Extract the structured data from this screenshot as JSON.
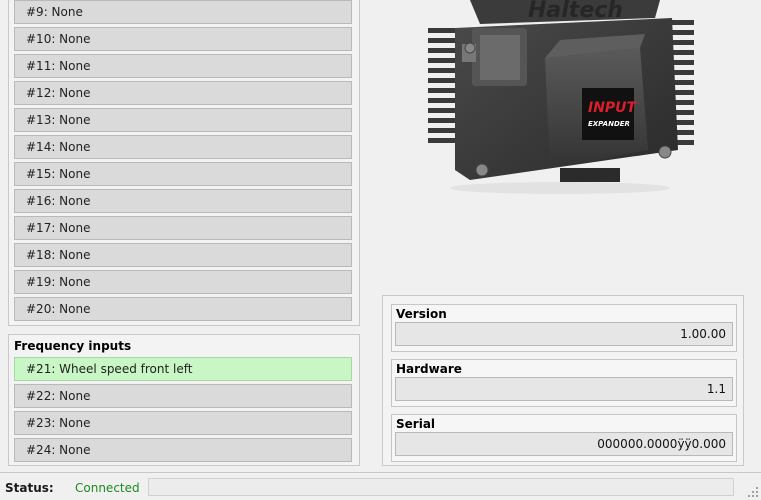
{
  "analog_inputs": [
    "#9: None",
    "#10: None",
    "#11: None",
    "#12: None",
    "#13: None",
    "#14: None",
    "#15: None",
    "#16: None",
    "#17: None",
    "#18: None",
    "#19: None",
    "#20: None"
  ],
  "frequency_inputs": {
    "title": "Frequency inputs",
    "items": [
      "#21: Wheel speed front left",
      "#22: None",
      "#23: None",
      "#24: None"
    ],
    "active_index": 0
  },
  "device": {
    "brand_text": "Haltech",
    "label_line1": "INPUT",
    "label_line2": "EXPANDER"
  },
  "info": {
    "version_label": "Version",
    "version_value": "1.00.00",
    "hardware_label": "Hardware",
    "hardware_value": "1.1",
    "serial_label": "Serial",
    "serial_value": "000000.0000ÿÿ0.000"
  },
  "status": {
    "label": "Status:",
    "value": "Connected"
  },
  "colors": {
    "active_row": "#c8f6c4",
    "connected": "#1e8a1e",
    "device_label": "#d91f2a"
  }
}
